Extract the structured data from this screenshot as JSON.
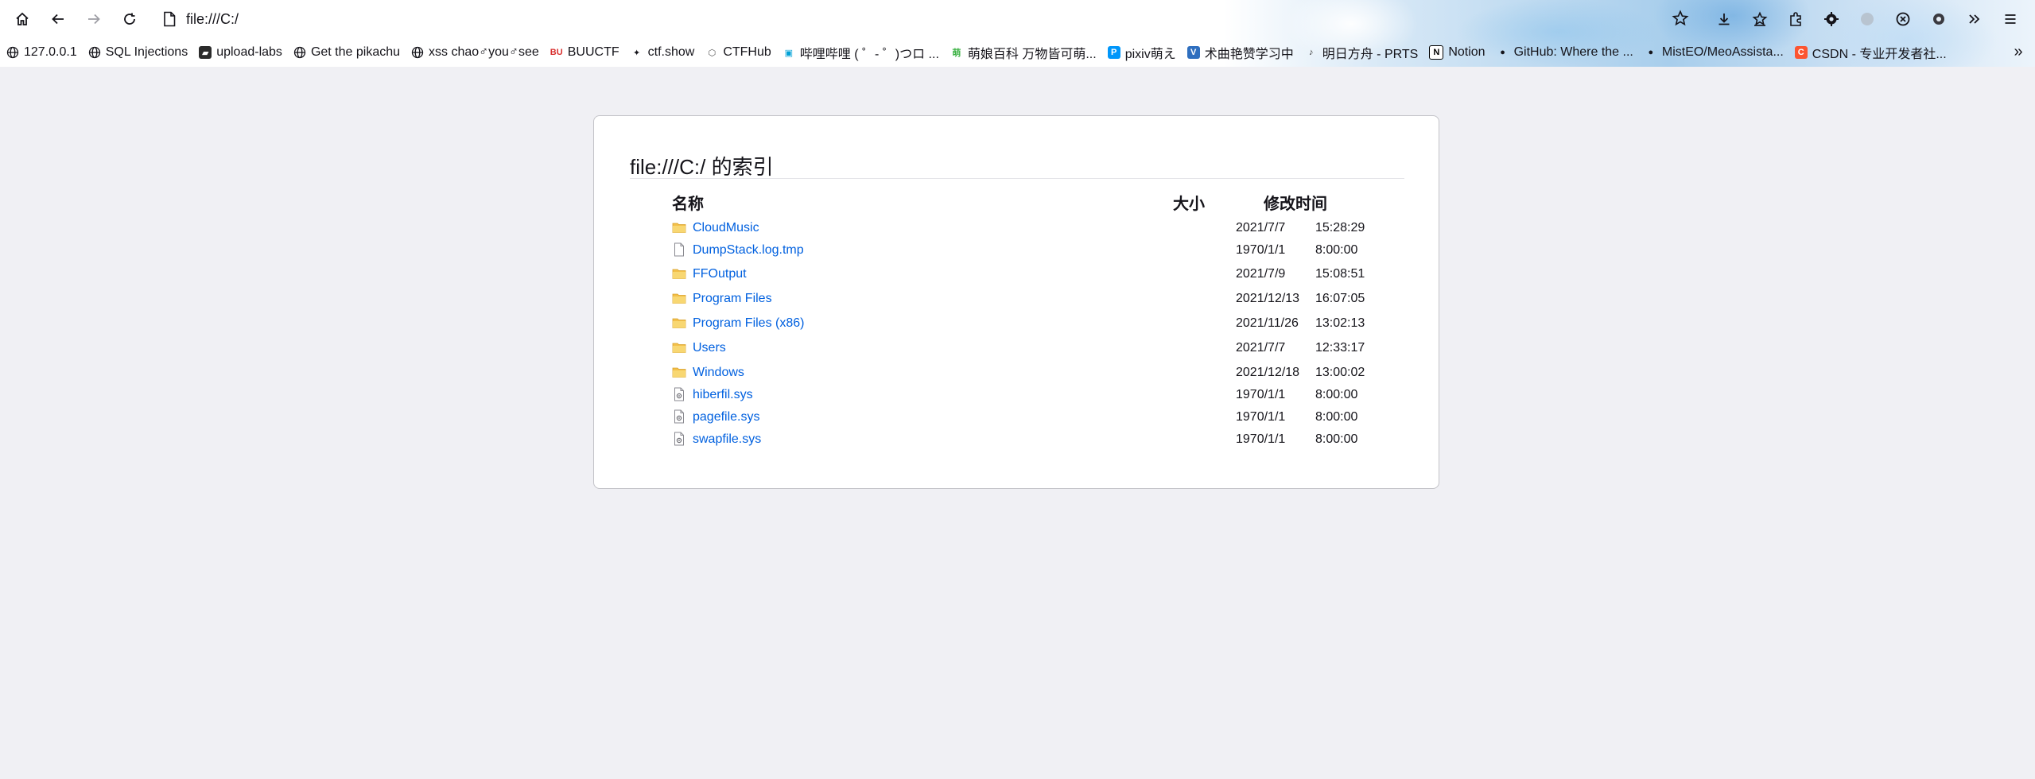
{
  "browser": {
    "url": "file:///C:/",
    "nav": {
      "home_icon": "home-icon",
      "back_icon": "back-arrow-icon",
      "forward_icon": "forward-arrow-icon",
      "reload_icon": "reload-icon"
    },
    "toolbar_icons": [
      "star-icon",
      "download-icon",
      "bookmark-star-icon",
      "extensions-icon",
      "settings-gear-icon",
      "profile-icon",
      "shield-icon",
      "gear-icon",
      "overflow-chevron-icon",
      "hamburger-menu-icon"
    ],
    "bookmarks": [
      {
        "label": "127.0.0.1",
        "icon": "globe-icon"
      },
      {
        "label": "SQL Injections",
        "icon": "globe-icon"
      },
      {
        "label": "upload-labs",
        "icon": "upload-labs-icon"
      },
      {
        "label": "Get the pikachu",
        "icon": "globe-icon"
      },
      {
        "label": "xss chao♂you♂see",
        "icon": "globe-icon"
      },
      {
        "label": "BUUCTF",
        "icon": "buuctf-icon"
      },
      {
        "label": "ctf.show",
        "icon": "ctfshow-icon"
      },
      {
        "label": "CTFHub",
        "icon": "ctfhub-icon"
      },
      {
        "label": "哔哩哔哩 ( ゜- ゜)つロ ...",
        "icon": "bilibili-icon"
      },
      {
        "label": "萌娘百科 万物皆可萌...",
        "icon": "moegirl-icon"
      },
      {
        "label": "pixiv萌え",
        "icon": "pixiv-icon"
      },
      {
        "label": "术曲艳赞学习中",
        "icon": "v-icon"
      },
      {
        "label": "明日方舟 - PRTS",
        "icon": "prts-icon"
      },
      {
        "label": "Notion",
        "icon": "notion-icon"
      },
      {
        "label": "GitHub: Where the ...",
        "icon": "github-icon"
      },
      {
        "label": "MistEO/MeoAssista...",
        "icon": "github-icon"
      },
      {
        "label": "CSDN - 专业开发者社...",
        "icon": "csdn-icon"
      }
    ]
  },
  "listing": {
    "heading": "file:///C:/ 的索引",
    "columns": {
      "name": "名称",
      "size": "大小",
      "modified": "修改时间"
    },
    "entries": [
      {
        "name": "CloudMusic",
        "type": "folder",
        "date": "2021/7/7",
        "time": "15:28:29"
      },
      {
        "name": "DumpStack.log.tmp",
        "type": "file",
        "date": "1970/1/1",
        "time": "8:00:00"
      },
      {
        "name": "FFOutput",
        "type": "folder",
        "date": "2021/7/9",
        "time": "15:08:51"
      },
      {
        "name": "Program Files",
        "type": "folder",
        "date": "2021/12/13",
        "time": "16:07:05"
      },
      {
        "name": "Program Files (x86)",
        "type": "folder",
        "date": "2021/11/26",
        "time": "13:02:13"
      },
      {
        "name": "Users",
        "type": "folder",
        "date": "2021/7/7",
        "time": "12:33:17"
      },
      {
        "name": "Windows",
        "type": "folder",
        "date": "2021/12/18",
        "time": "13:00:02"
      },
      {
        "name": "hiberfil.sys",
        "type": "system-file",
        "date": "1970/1/1",
        "time": "8:00:00"
      },
      {
        "name": "pagefile.sys",
        "type": "system-file",
        "date": "1970/1/1",
        "time": "8:00:00"
      },
      {
        "name": "swapfile.sys",
        "type": "system-file",
        "date": "1970/1/1",
        "time": "8:00:00"
      }
    ]
  },
  "colors": {
    "link": "#0060df",
    "page_bg": "#f0f0f4",
    "folder": "#f5c542"
  }
}
